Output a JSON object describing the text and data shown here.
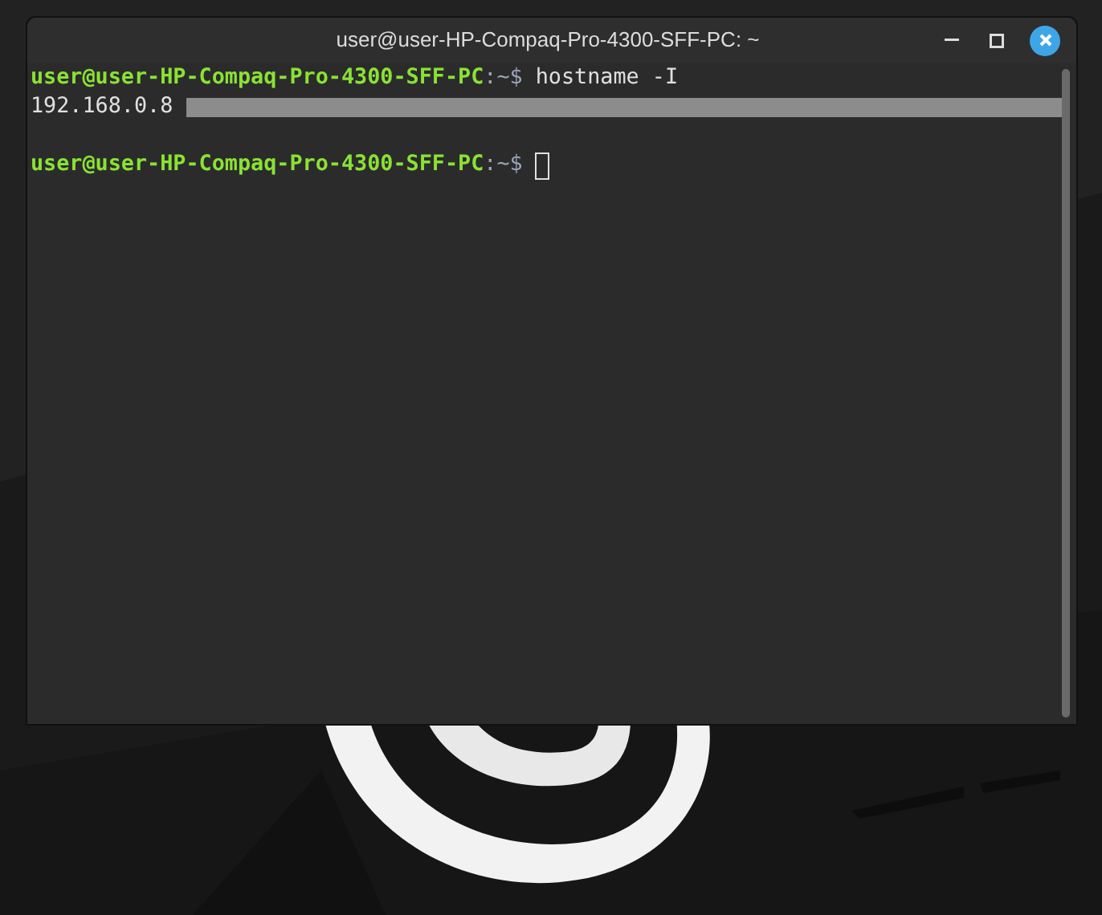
{
  "window": {
    "title": "user@user-HP-Compaq-Pro-4300-SFF-PC: ~"
  },
  "terminal": {
    "lines": [
      {
        "kind": "prompt",
        "user": "user@user-HP-Compaq-Pro-4300-SFF-PC",
        "path": ":~$",
        "command": "hostname -I",
        "cursor": false
      },
      {
        "kind": "output",
        "text": "192.168.0.8",
        "redacted": true
      },
      {
        "kind": "blank"
      },
      {
        "kind": "prompt",
        "user": "user@user-HP-Compaq-Pro-4300-SFF-PC",
        "path": ":~$",
        "cursor": true
      }
    ]
  }
}
